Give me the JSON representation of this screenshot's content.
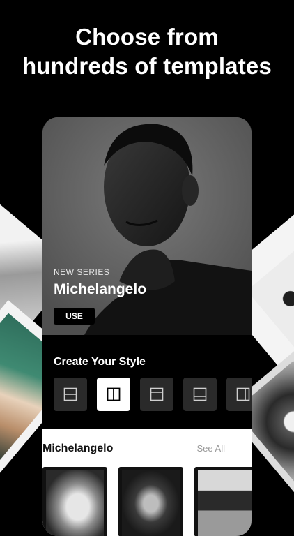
{
  "headline": {
    "line1": "Choose from",
    "line2": "hundreds of templates"
  },
  "hero": {
    "tag": "NEW SERIES",
    "title": "Michelangelo",
    "button": "USE"
  },
  "style_section": {
    "title": "Create Your Style",
    "layouts": [
      {
        "icon": "layout-split-horizontal-icon",
        "active": false
      },
      {
        "icon": "layout-split-vertical-icon",
        "active": true
      },
      {
        "icon": "layout-top-band-icon",
        "active": false
      },
      {
        "icon": "layout-bottom-band-icon",
        "active": false
      },
      {
        "icon": "layout-side-panel-icon",
        "active": false
      }
    ]
  },
  "collection": {
    "title": "Michelangelo",
    "see_all": "See All"
  },
  "colors": {
    "background": "#000000",
    "active_layout": "#ffffff",
    "inactive_layout": "#2a2a2a"
  }
}
